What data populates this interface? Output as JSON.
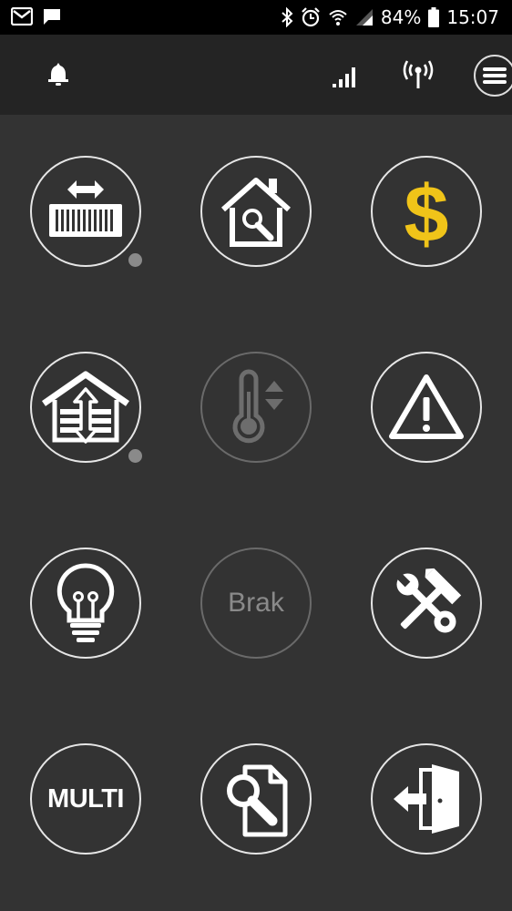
{
  "status_bar": {
    "battery_percent": "84%",
    "time": "15:07",
    "left_icons": [
      "gmail-icon",
      "message-icon"
    ],
    "right_icons": [
      "bluetooth-icon",
      "alarm-icon",
      "wifi-icon",
      "cell-signal-icon",
      "battery-icon"
    ]
  },
  "app_bar": {
    "icons": [
      "bell-icon",
      "signal-bars-icon",
      "antenna-icon",
      "menu-icon"
    ]
  },
  "tiles": [
    {
      "name": "gate",
      "icon": "sliding-gate-icon",
      "has_dot": true
    },
    {
      "name": "house-search",
      "icon": "house-search-icon",
      "has_dot": false
    },
    {
      "name": "payments",
      "icon": "dollar-icon",
      "accent": "#f0c419",
      "has_dot": false
    },
    {
      "name": "garage",
      "icon": "garage-door-icon",
      "has_dot": true
    },
    {
      "name": "thermostat",
      "icon": "thermometer-icon",
      "disabled": true,
      "has_dot": false
    },
    {
      "name": "alarm-warning",
      "icon": "warning-icon",
      "has_dot": false
    },
    {
      "name": "lighting",
      "icon": "lightbulb-icon",
      "has_dot": false
    },
    {
      "name": "brak",
      "label": "Brak",
      "disabled": true,
      "has_dot": false
    },
    {
      "name": "tools",
      "icon": "tools-icon",
      "has_dot": false
    },
    {
      "name": "multi",
      "label": "MULTI",
      "has_dot": false
    },
    {
      "name": "document-search",
      "icon": "document-search-icon",
      "has_dot": false
    },
    {
      "name": "exit",
      "icon": "exit-door-icon",
      "has_dot": false
    }
  ]
}
